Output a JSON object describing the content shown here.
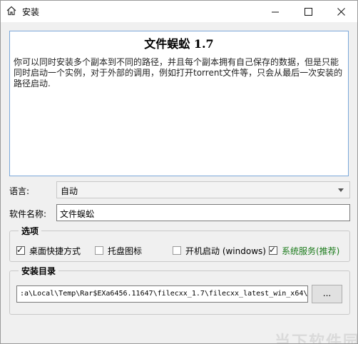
{
  "window": {
    "title": "安装",
    "controls": {
      "minimize_icon": "minimize-icon",
      "maximize_icon": "maximize-icon",
      "close_icon": "close-icon"
    }
  },
  "info": {
    "heading": "文件蜈蚣  1.7",
    "body": "你可以同时安装多个副本到不同的路径，并且每个副本拥有自己保存的数据，但是只能同时启动一个实例，对于外部的调用，例如打开torrent文件等，只会从最后一次安装的路径启动."
  },
  "language": {
    "label": "语言:",
    "value": "自动"
  },
  "software_name": {
    "label": "软件名称:",
    "value": "文件蜈蚣"
  },
  "options": {
    "title": "选项",
    "items": [
      {
        "label": "桌面快捷方式",
        "checked": true
      },
      {
        "label": "托盘图标",
        "checked": false
      },
      {
        "label": "开机启动 (windows)",
        "checked": false
      },
      {
        "label": "系统服务(推荐)",
        "checked": true,
        "color": "#1a7a1a"
      }
    ]
  },
  "install_dir": {
    "title": "安装目录",
    "path": ":a\\Local\\Temp\\Rar$EXa6456.11647\\filecxx_1.7\\filecxx_latest_win_x64\\",
    "browse_label": "..."
  },
  "watermark": "当下软件园"
}
